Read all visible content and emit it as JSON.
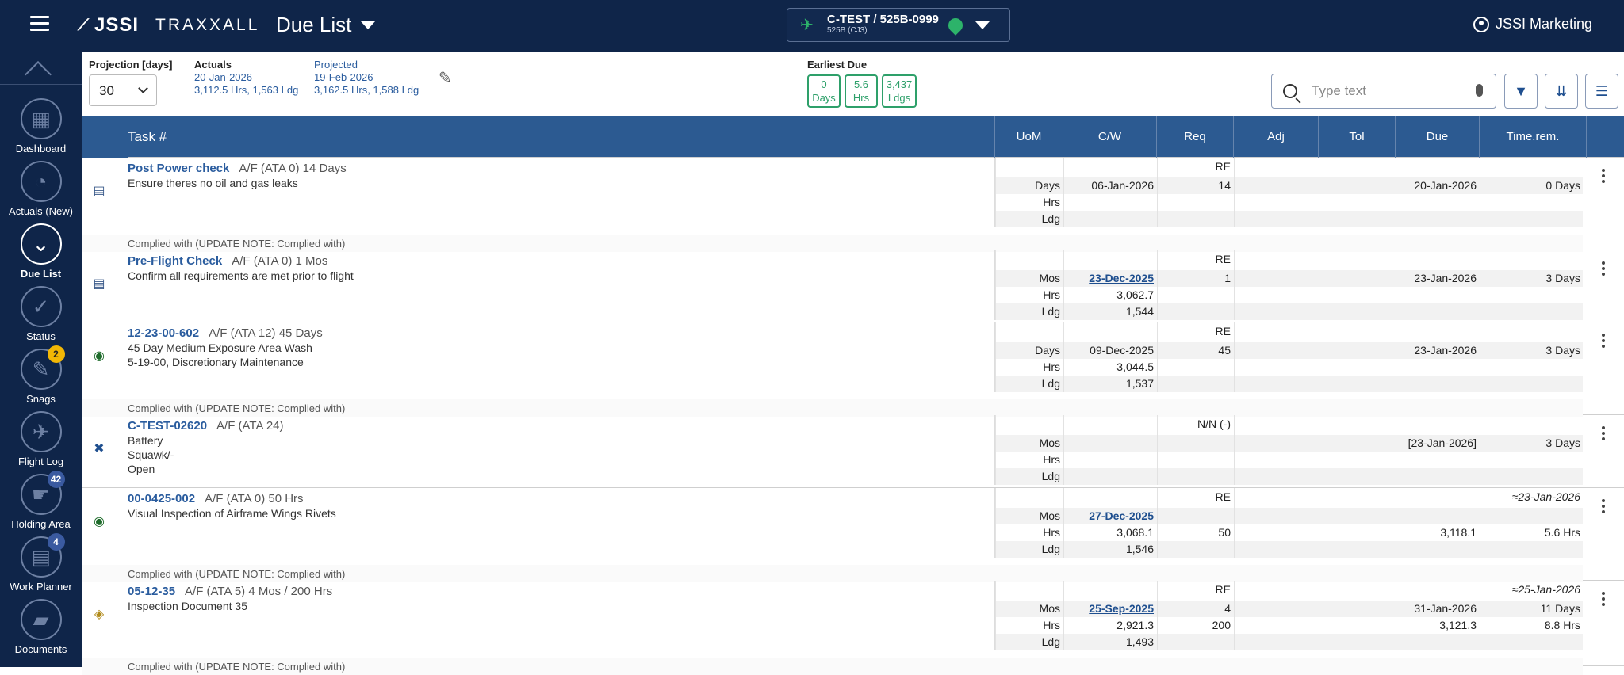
{
  "app": {
    "logo_text": "JSSI",
    "logo_sub": "TRAXXALL",
    "page_title": "Due List"
  },
  "aircraft": {
    "registration": "C-TEST / 525B-0999",
    "model": "525B (CJ3)"
  },
  "user": {
    "name": "JSSI Marketing"
  },
  "sidebar": {
    "items": [
      {
        "label": "Dashboard",
        "icon": "dashboard-icon",
        "glyph": "▦"
      },
      {
        "label": "Actuals (New)",
        "icon": "clock-icon",
        "glyph": "◔"
      },
      {
        "label": "Due List",
        "icon": "chevrons-down-icon",
        "glyph": "⌄"
      },
      {
        "label": "Status",
        "icon": "check-icon",
        "glyph": "✓"
      },
      {
        "label": "Snags",
        "icon": "wrench-icon",
        "glyph": "✎",
        "badge": "2"
      },
      {
        "label": "Flight Log",
        "icon": "flight-log-icon",
        "glyph": "✈"
      },
      {
        "label": "Holding Area",
        "icon": "hand-icon",
        "glyph": "☛",
        "badge": "42"
      },
      {
        "label": "Work Planner",
        "icon": "clipboard-icon",
        "glyph": "▤",
        "badge": "4"
      },
      {
        "label": "Documents",
        "icon": "folder-icon",
        "glyph": "▰"
      }
    ]
  },
  "summary": {
    "projection_label": "Projection [days]",
    "projection_value": "30",
    "actuals_label": "Actuals",
    "actuals_date": "20-Jan-2026",
    "actuals_values": "3,112.5 Hrs, 1,563 Ldg",
    "projected_label": "Projected",
    "projected_date": "19-Feb-2026",
    "projected_values": "3,162.5 Hrs, 1,588 Ldg",
    "earliest_label": "Earliest Due",
    "earliest": [
      {
        "num": "0",
        "unit": "Days"
      },
      {
        "num": "5.6",
        "unit": "Hrs"
      },
      {
        "num": "3,437",
        "unit": "Ldgs"
      }
    ],
    "search_placeholder": "Type text"
  },
  "table": {
    "headers": {
      "task": "Task #",
      "uom": "UoM",
      "cw": "C/W",
      "req": "Req",
      "adj": "Adj",
      "tol": "Tol",
      "due": "Due",
      "timerem": "Time.rem."
    },
    "tasks": [
      {
        "code": "Post Power check",
        "meta": "A/F (ATA 0) 14 Days",
        "desc": [
          "Ensure theres no oil and gas leaks"
        ],
        "note": "Complied with (UPDATE NOTE: Complied with)",
        "rows": [
          {
            "uom": "",
            "cw": "",
            "req": "RE",
            "due": "",
            "rem": ""
          },
          {
            "uom": "Days",
            "cw": "06-Jan-2026",
            "req": "14",
            "due": "20-Jan-2026",
            "rem": "0 Days"
          },
          {
            "uom": "Hrs",
            "cw": "",
            "req": "",
            "due": "",
            "rem": ""
          },
          {
            "uom": "Ldg",
            "cw": "",
            "req": "",
            "due": "",
            "rem": ""
          }
        ]
      },
      {
        "code": "Pre-Flight Check",
        "meta": "A/F (ATA 0) 1 Mos",
        "desc": [
          "Confirm all requirements are met prior to flight"
        ],
        "note": "",
        "rows": [
          {
            "uom": "",
            "cw": "",
            "req": "RE",
            "due": "",
            "rem": ""
          },
          {
            "uom": "Mos",
            "cw": "23-Dec-2025",
            "cwlink": true,
            "req": "1",
            "due": "23-Jan-2026",
            "rem": "3 Days"
          },
          {
            "uom": "Hrs",
            "cw": "3,062.7",
            "req": "",
            "due": "",
            "rem": ""
          },
          {
            "uom": "Ldg",
            "cw": "1,544",
            "req": "",
            "due": "",
            "rem": ""
          }
        ]
      },
      {
        "code": "12-23-00-602",
        "meta": "A/F (ATA 12) 45 Days",
        "desc": [
          "45 Day Medium Exposure Area Wash",
          "5-19-00, Discretionary Maintenance"
        ],
        "note": "Complied with (UPDATE NOTE: Complied with)",
        "rows": [
          {
            "uom": "",
            "cw": "",
            "req": "RE",
            "due": "",
            "rem": ""
          },
          {
            "uom": "Days",
            "cw": "09-Dec-2025",
            "req": "45",
            "due": "23-Jan-2026",
            "rem": "3 Days"
          },
          {
            "uom": "Hrs",
            "cw": "3,044.5",
            "req": "",
            "due": "",
            "rem": ""
          },
          {
            "uom": "Ldg",
            "cw": "1,537",
            "req": "",
            "due": "",
            "rem": ""
          }
        ]
      },
      {
        "code": "C-TEST-02620",
        "meta": "A/F (ATA 24)",
        "desc": [
          "Battery",
          "Squawk/-",
          "Open"
        ],
        "note": "",
        "rows": [
          {
            "uom": "",
            "cw": "",
            "req": "N/N (-)",
            "due": "",
            "rem": ""
          },
          {
            "uom": "Mos",
            "cw": "",
            "req": "",
            "due": "[23-Jan-2026]",
            "rem": "3 Days"
          },
          {
            "uom": "Hrs",
            "cw": "",
            "req": "",
            "due": "",
            "rem": ""
          },
          {
            "uom": "Ldg",
            "cw": "",
            "req": "",
            "due": "",
            "rem": ""
          }
        ]
      },
      {
        "code": "00-0425-002",
        "meta": "A/F (ATA 0) 50 Hrs",
        "desc": [
          "Visual Inspection of Airframe Wings Rivets"
        ],
        "note": "Complied with (UPDATE NOTE: Complied with)",
        "rows": [
          {
            "uom": "",
            "cw": "",
            "req": "RE",
            "due": "",
            "rem": "≈23-Jan-2026",
            "remital": true
          },
          {
            "uom": "Mos",
            "cw": "27-Dec-2025",
            "cwlink": true,
            "req": "",
            "due": "",
            "rem": ""
          },
          {
            "uom": "Hrs",
            "cw": "3,068.1",
            "req": "50",
            "due": "3,118.1",
            "rem": "5.6 Hrs"
          },
          {
            "uom": "Ldg",
            "cw": "1,546",
            "req": "",
            "due": "",
            "rem": ""
          }
        ]
      },
      {
        "code": "05-12-35",
        "meta": "A/F (ATA 5) 4 Mos / 200 Hrs",
        "desc": [
          "Inspection Document 35"
        ],
        "note": "Complied with (UPDATE NOTE: Complied with)",
        "rows": [
          {
            "uom": "",
            "cw": "",
            "req": "RE",
            "due": "",
            "rem": "≈25-Jan-2026",
            "remital": true
          },
          {
            "uom": "Mos",
            "cw": "25-Sep-2025",
            "cwlink": true,
            "req": "4",
            "due": "31-Jan-2026",
            "rem": "11 Days"
          },
          {
            "uom": "Hrs",
            "cw": "2,921.3",
            "req": "200",
            "due": "3,121.3",
            "rem": "8.8 Hrs"
          },
          {
            "uom": "Ldg",
            "cw": "1,493",
            "req": "",
            "due": "",
            "rem": ""
          }
        ]
      }
    ]
  }
}
